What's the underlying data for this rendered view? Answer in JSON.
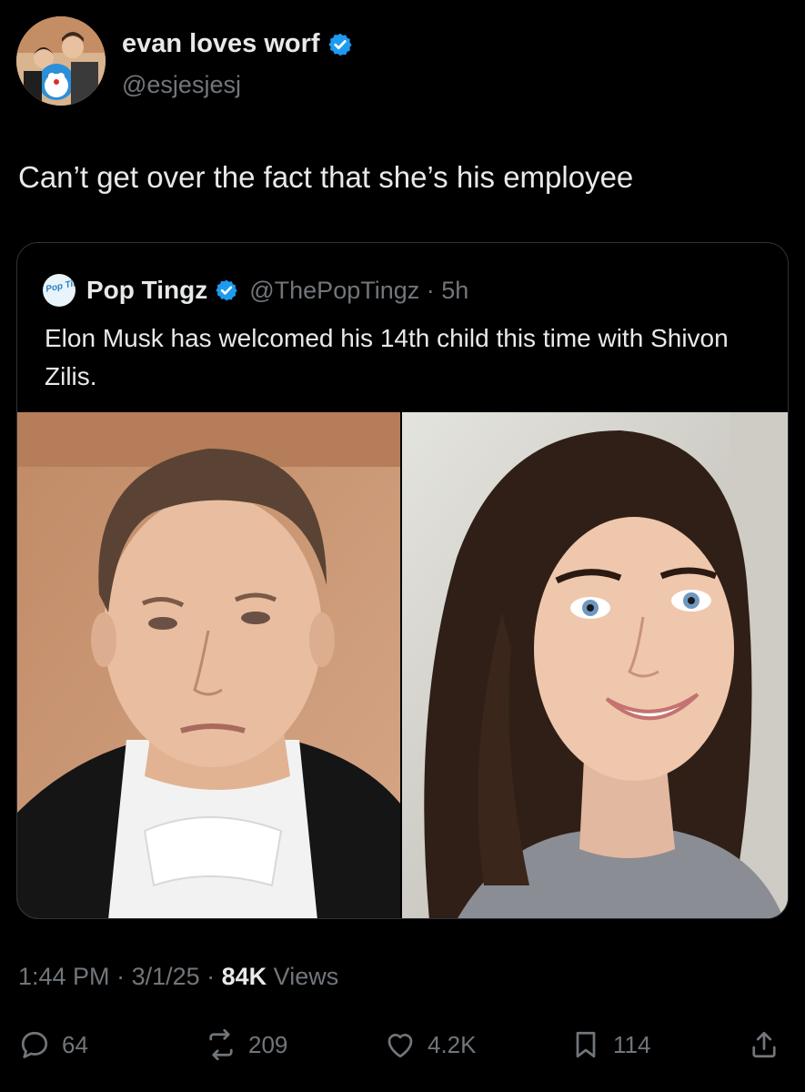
{
  "author": {
    "display_name": "evan loves worf",
    "handle": "@esjesjesj",
    "verified_icon": "verified-badge-icon"
  },
  "tweet": {
    "text": "Can’t get over the fact that she’s his employee"
  },
  "quoted": {
    "display_name": "Pop Tingz",
    "logo_text": "Pop Tingz",
    "handle_time": "@ThePopTingz · 5h",
    "text": "Elon Musk has welcomed his 14th child this time with Shivon Zilis."
  },
  "meta": {
    "time": "1:44 PM",
    "sep1": " · ",
    "date": "3/1/25",
    "sep2": " · ",
    "views_count": "84K",
    "views_label": " Views"
  },
  "actions": {
    "replies": "64",
    "reposts": "209",
    "likes": "4.2K",
    "bookmarks": "114"
  },
  "colors": {
    "background": "#000000",
    "primary_text": "#e7e9ea",
    "secondary_text": "#71767b",
    "verified_blue": "#1d9bf0",
    "border": "#2f3336"
  }
}
